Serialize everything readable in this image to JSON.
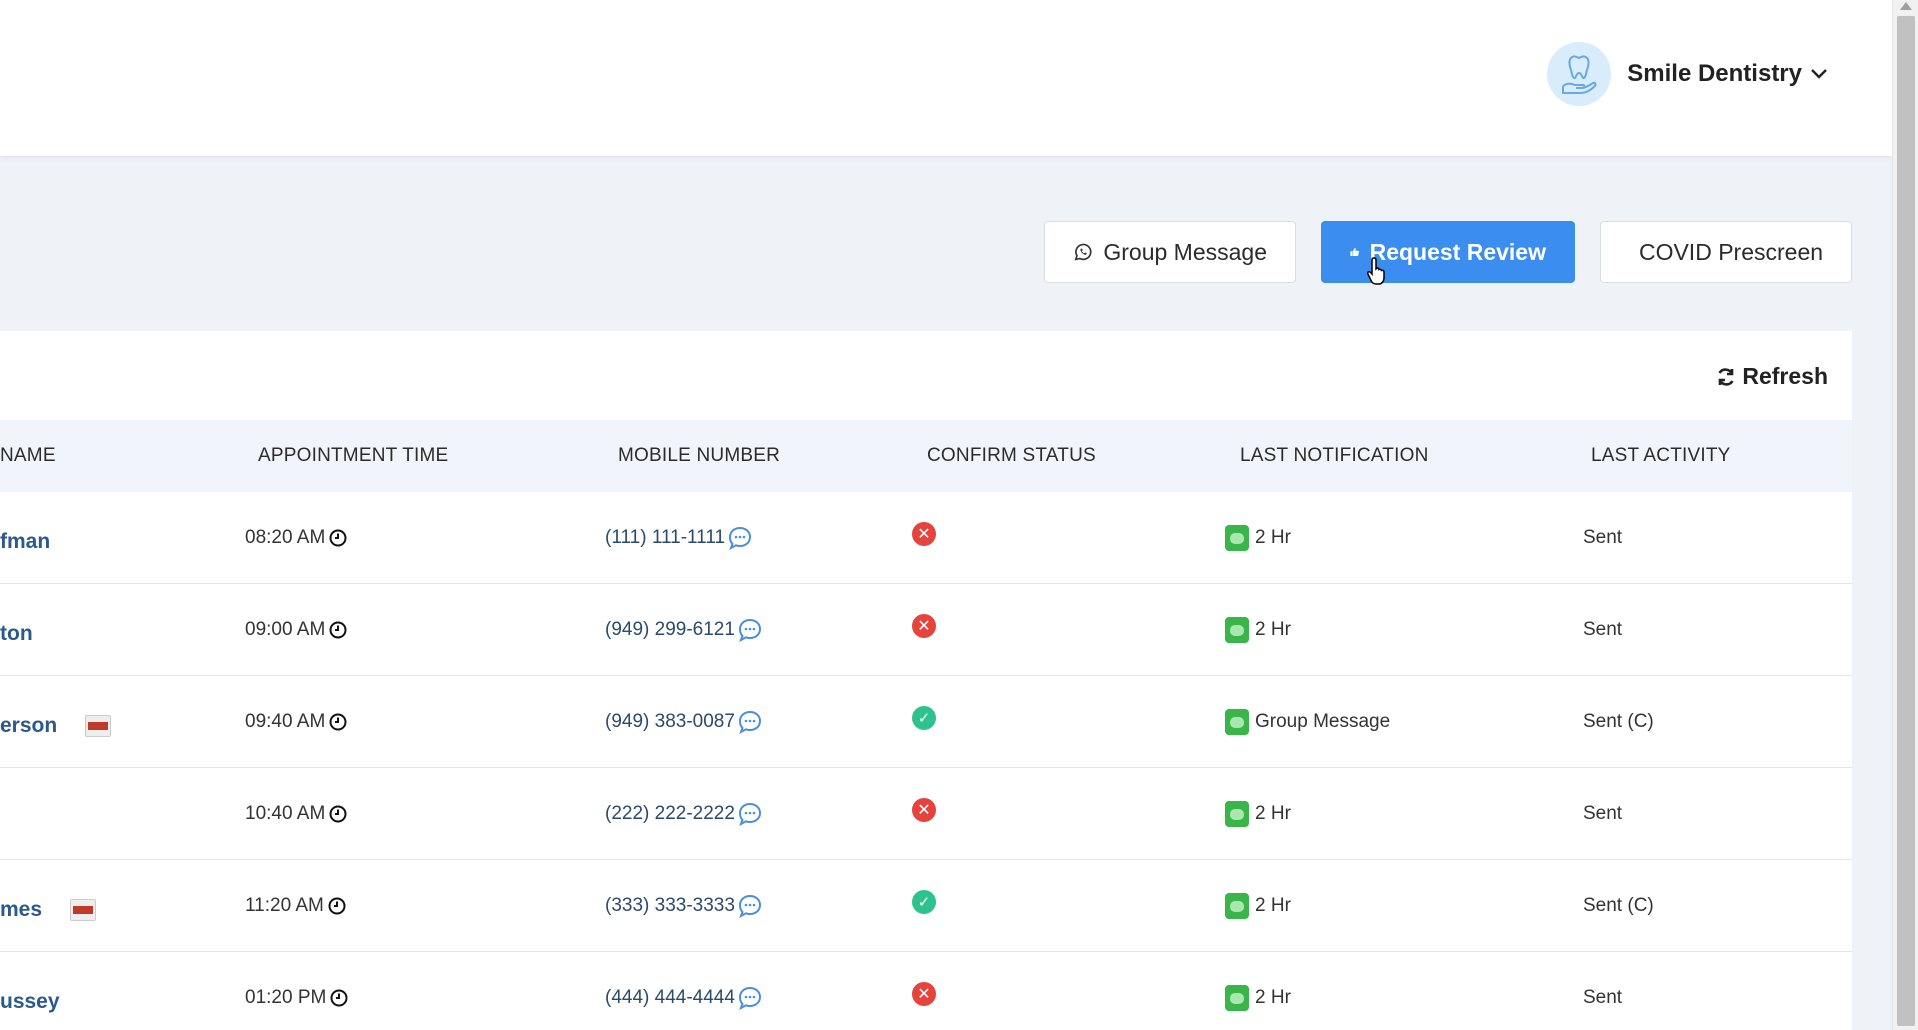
{
  "header": {
    "account_name": "Smile Dentistry",
    "avatar_icon": "tooth-hand-icon"
  },
  "actions": {
    "group_message": "Group Message",
    "request_review": "Request Review",
    "covid_prescreen": "COVID Prescreen"
  },
  "table": {
    "refresh_label": "Refresh",
    "columns": {
      "name": "NAME",
      "appointment_time": "APPOINTMENT TIME",
      "mobile_number": "MOBILE NUMBER",
      "confirm_status": "CONFIRM STATUS",
      "last_notification": "LAST NOTIFICATION",
      "last_activity": "LAST ACTIVITY"
    },
    "rows": [
      {
        "name": "fman",
        "pdf": false,
        "time": "08:20 AM",
        "phone": "(111) 111-1111",
        "confirmed": false,
        "notification": "2 Hr",
        "activity": "Sent"
      },
      {
        "name": "ton",
        "pdf": false,
        "time": "09:00 AM",
        "phone": "(949) 299-6121",
        "confirmed": false,
        "notification": "2 Hr",
        "activity": "Sent"
      },
      {
        "name": "erson",
        "pdf": true,
        "time": "09:40 AM",
        "phone": "(949) 383-0087",
        "confirmed": true,
        "notification": "Group Message",
        "activity": "Sent (C)"
      },
      {
        "name": "",
        "pdf": false,
        "time": "10:40 AM",
        "phone": "(222) 222-2222",
        "confirmed": false,
        "notification": "2 Hr",
        "activity": "Sent"
      },
      {
        "name": "mes",
        "pdf": true,
        "time": "11:20 AM",
        "phone": "(333) 333-3333",
        "confirmed": true,
        "notification": "2 Hr",
        "activity": "Sent (C)"
      },
      {
        "name": "ussey",
        "pdf": false,
        "time": "01:20 PM",
        "phone": "(444) 444-4444",
        "confirmed": false,
        "notification": "2 Hr",
        "activity": "Sent"
      }
    ]
  },
  "colors": {
    "primary": "#3b8ef0",
    "confirmed": "#2ec28f",
    "unconfirmed": "#e5433d",
    "sms": "#39b54a",
    "link": "#2a5a8c"
  }
}
